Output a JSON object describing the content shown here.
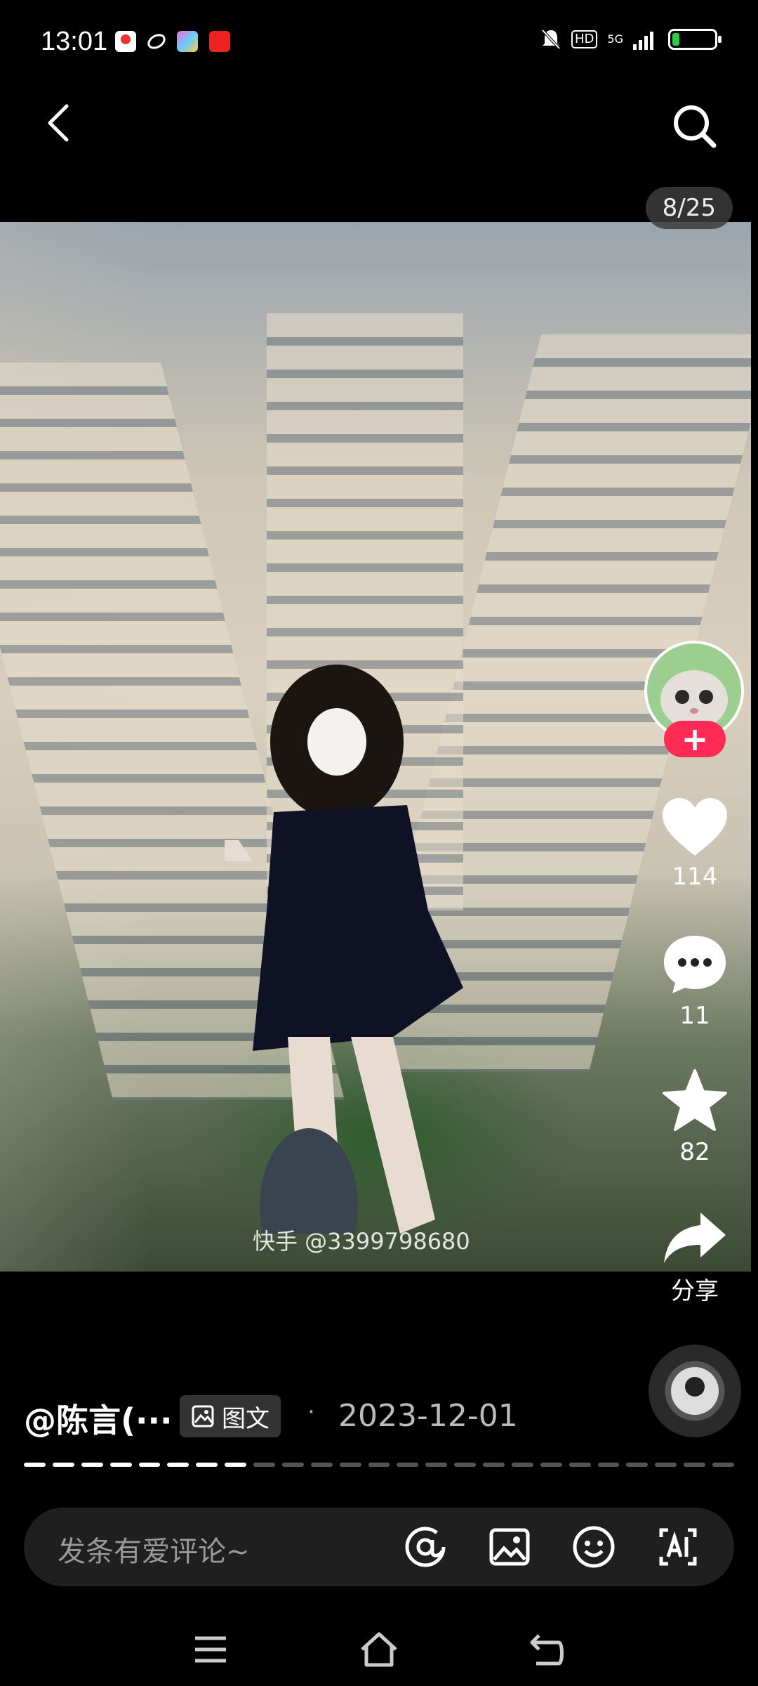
{
  "status_bar": {
    "time": "13:01",
    "hd_label": "HD",
    "network": "5G",
    "battery_level": 0.18,
    "battery_color": "#2ecc40"
  },
  "header": {
    "back_icon": "chevron-left-icon",
    "search_icon": "search-icon"
  },
  "photo": {
    "counter": "8/25",
    "watermark": "快手 @3399798680"
  },
  "actions": {
    "like_count": "114",
    "comment_count": "11",
    "favorite_count": "82",
    "share_label": "分享",
    "follow_symbol": "+"
  },
  "post": {
    "author": "@陈言(···",
    "tag_label": "图文",
    "separator": "·",
    "date": "2023-12-01",
    "progress_total": 25,
    "progress_current": 8
  },
  "comment_bar": {
    "placeholder": "发条有爱评论~",
    "icons": [
      "at-icon",
      "image-icon",
      "emoji-icon",
      "ai-icon"
    ]
  },
  "colors": {
    "follow_accent": "#ff2a55",
    "background": "#000000"
  }
}
